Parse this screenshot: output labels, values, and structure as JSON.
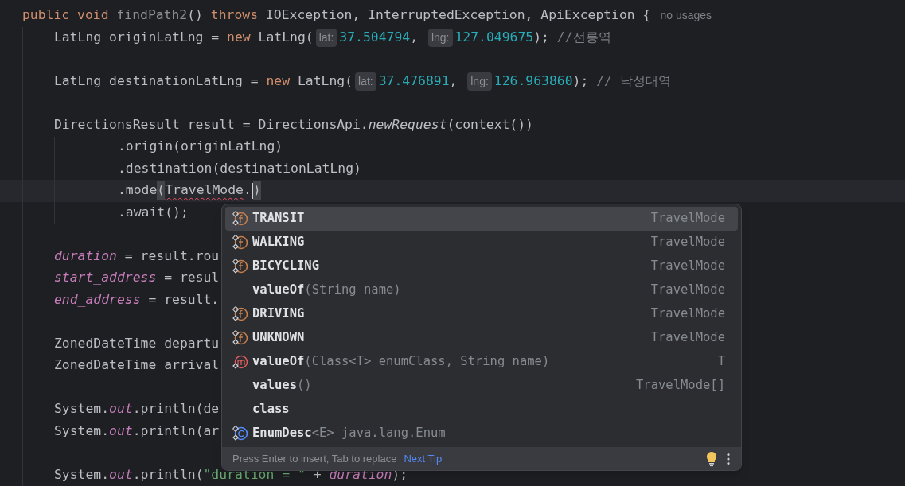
{
  "editor": {
    "lines": [
      {
        "kind": "signature",
        "current": false,
        "tokens": [
          {
            "kind": "keyword",
            "text": "public void "
          },
          {
            "kind": "unused",
            "text": "findPath2"
          },
          {
            "kind": "plain",
            "text": "() "
          },
          {
            "kind": "keyword",
            "text": "throws "
          },
          {
            "kind": "plain",
            "text": "IOException, InterruptedException, ApiException {"
          },
          {
            "kind": "usage",
            "text": "no usages"
          }
        ]
      },
      {
        "kind": "statement",
        "current": false,
        "tokens": [
          {
            "kind": "plain",
            "text": "LatLng originLatLng = "
          },
          {
            "kind": "keyword",
            "text": "new "
          },
          {
            "kind": "plain",
            "text": "LatLng("
          },
          {
            "kind": "hint",
            "text": "lat:"
          },
          {
            "kind": "number",
            "text": "37.504794"
          },
          {
            "kind": "plain",
            "text": ", "
          },
          {
            "kind": "hint",
            "text": "lng:"
          },
          {
            "kind": "number",
            "text": "127.049675"
          },
          {
            "kind": "plain",
            "text": "); "
          },
          {
            "kind": "comment",
            "text": "//선릉역"
          }
        ]
      },
      {
        "kind": "blank"
      },
      {
        "kind": "statement",
        "current": false,
        "tokens": [
          {
            "kind": "plain",
            "text": "LatLng destinationLatLng = "
          },
          {
            "kind": "keyword",
            "text": "new "
          },
          {
            "kind": "plain",
            "text": "LatLng("
          },
          {
            "kind": "hint",
            "text": "lat:"
          },
          {
            "kind": "number",
            "text": "37.476891"
          },
          {
            "kind": "plain",
            "text": ", "
          },
          {
            "kind": "hint",
            "text": "lng:"
          },
          {
            "kind": "number",
            "text": "126.963860"
          },
          {
            "kind": "plain",
            "text": "); "
          },
          {
            "kind": "comment",
            "text": "// 낙성대역"
          }
        ]
      },
      {
        "kind": "blank"
      },
      {
        "kind": "statement",
        "current": false,
        "tokens": [
          {
            "kind": "plain",
            "text": "DirectionsResult result = DirectionsApi."
          },
          {
            "kind": "static",
            "text": "newRequest"
          },
          {
            "kind": "plain",
            "text": "(context())"
          }
        ]
      },
      {
        "kind": "chain",
        "current": false,
        "tokens": [
          {
            "kind": "plain",
            "text": ".origin(originLatLng)"
          }
        ]
      },
      {
        "kind": "chain",
        "current": false,
        "tokens": [
          {
            "kind": "plain",
            "text": ".destination(destinationLatLng)"
          }
        ]
      },
      {
        "kind": "chain",
        "current": true,
        "tokens": [
          {
            "kind": "plain",
            "text": ".mode"
          },
          {
            "kind": "brace",
            "text": "("
          },
          {
            "kind": "error",
            "text": "TravelMode"
          },
          {
            "kind": "plain",
            "text": "."
          },
          {
            "kind": "caret"
          },
          {
            "kind": "brace",
            "text": ")"
          }
        ]
      },
      {
        "kind": "chain",
        "current": false,
        "tokens": [
          {
            "kind": "plain",
            "text": ".await();"
          }
        ]
      },
      {
        "kind": "blank"
      },
      {
        "kind": "statement",
        "current": false,
        "tokens": [
          {
            "kind": "field",
            "text": "duration"
          },
          {
            "kind": "plain",
            "text": " = result.rou"
          }
        ]
      },
      {
        "kind": "statement",
        "current": false,
        "tokens": [
          {
            "kind": "field",
            "text": "start_address"
          },
          {
            "kind": "plain",
            "text": " = resul"
          }
        ]
      },
      {
        "kind": "statement",
        "current": false,
        "tokens": [
          {
            "kind": "field",
            "text": "end_address"
          },
          {
            "kind": "plain",
            "text": " = result."
          }
        ]
      },
      {
        "kind": "blank"
      },
      {
        "kind": "statement",
        "current": false,
        "tokens": [
          {
            "kind": "plain",
            "text": "ZonedDateTime departu"
          }
        ]
      },
      {
        "kind": "statement",
        "current": false,
        "tokens": [
          {
            "kind": "plain",
            "text": "ZonedDateTime arrival"
          }
        ]
      },
      {
        "kind": "blank"
      },
      {
        "kind": "statement",
        "current": false,
        "tokens": [
          {
            "kind": "plain",
            "text": "System."
          },
          {
            "kind": "field",
            "text": "out"
          },
          {
            "kind": "plain",
            "text": ".println(de"
          }
        ]
      },
      {
        "kind": "statement",
        "current": false,
        "tokens": [
          {
            "kind": "plain",
            "text": "System."
          },
          {
            "kind": "field",
            "text": "out"
          },
          {
            "kind": "plain",
            "text": ".println(ar"
          }
        ]
      },
      {
        "kind": "blank"
      },
      {
        "kind": "statement",
        "current": false,
        "tokens": [
          {
            "kind": "plain",
            "text": "System."
          },
          {
            "kind": "field",
            "text": "out"
          },
          {
            "kind": "plain",
            "text": ".println("
          },
          {
            "kind": "string",
            "text": "\"duration = \""
          },
          {
            "kind": "plain",
            "text": " + "
          },
          {
            "kind": "field",
            "text": "duration"
          },
          {
            "kind": "plain",
            "text": ");"
          }
        ]
      }
    ]
  },
  "completion_popup": {
    "items": [
      {
        "kind": "enum_field",
        "name": "TRANSIT",
        "type": "TravelMode",
        "selected": true
      },
      {
        "kind": "enum_field",
        "name": "WALKING",
        "type": "TravelMode",
        "selected": false
      },
      {
        "kind": "enum_field",
        "name": "BICYCLING",
        "type": "TravelMode",
        "selected": false
      },
      {
        "kind": "plain",
        "name": "valueOf",
        "params": "(String name)",
        "type": "TravelMode",
        "selected": false
      },
      {
        "kind": "enum_field",
        "name": "DRIVING",
        "type": "TravelMode",
        "selected": false
      },
      {
        "kind": "enum_field",
        "name": "UNKNOWN",
        "type": "TravelMode",
        "selected": false
      },
      {
        "kind": "method",
        "name": "valueOf",
        "params": "(Class<T> enumClass, String name)",
        "type": "T",
        "selected": false
      },
      {
        "kind": "plain",
        "name": "values",
        "params": "()",
        "type": "TravelMode[]",
        "selected": false
      },
      {
        "kind": "plain",
        "name": "class",
        "selected": false
      },
      {
        "kind": "class",
        "name": "EnumDesc",
        "params": "<E> java.lang.Enum",
        "selected": false
      }
    ],
    "footer": {
      "hint": "Press Enter to insert, Tab to replace",
      "link": "Next Tip"
    }
  }
}
